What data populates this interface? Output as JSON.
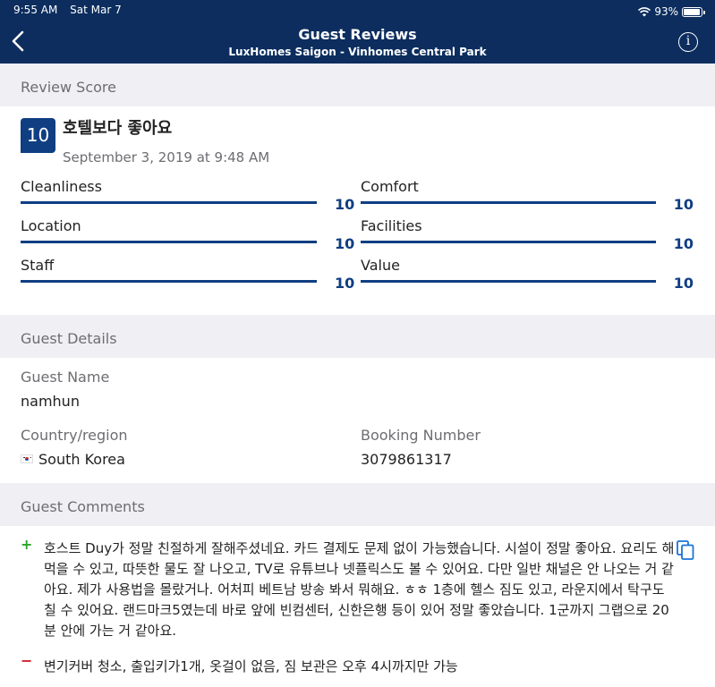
{
  "status": {
    "time": "9:55 AM",
    "date": "Sat Mar 7",
    "battery": "93%",
    "battery_level": 0.93
  },
  "nav": {
    "title": "Guest Reviews",
    "subtitle": "LuxHomes Saigon - Vinhomes Central Park",
    "back_icon": "chevron-left-icon",
    "info_icon": "info-icon",
    "info_glyph": "i"
  },
  "sections": {
    "review_score": "Review Score",
    "guest_details": "Guest Details",
    "guest_comments": "Guest Comments"
  },
  "review": {
    "score": "10",
    "title": "호텔보다 좋아요",
    "date": "September 3, 2019 at 9:48 AM",
    "ratings": [
      {
        "label": "Cleanliness",
        "value": "10",
        "fraction": 1.0
      },
      {
        "label": "Comfort",
        "value": "10",
        "fraction": 1.0
      },
      {
        "label": "Location",
        "value": "10",
        "fraction": 1.0
      },
      {
        "label": "Facilities",
        "value": "10",
        "fraction": 1.0
      },
      {
        "label": "Staff",
        "value": "10",
        "fraction": 1.0
      },
      {
        "label": "Value",
        "value": "10",
        "fraction": 1.0
      }
    ]
  },
  "guest": {
    "name_label": "Guest Name",
    "name": "namhun",
    "country_label": "Country/region",
    "country": "South Korea",
    "booking_label": "Booking Number",
    "booking_number": "3079861317"
  },
  "comments": {
    "positive_mark": "+",
    "negative_mark": "−",
    "positive": "호스트 Duy가 정말 친절하게 잘해주셨네요. 카드 결제도 문제 없이 가능했습니다. 시설이 정말 좋아요. 요리도 해먹을 수 있고, 따뜻한 물도 잘 나오고, TV로 유튜브나 넷플릭스도 볼 수 있어요. 다만 일반 채널은 안 나오는 거 같아요. 제가 사용법을 몰랐거나. 어처피 베트남 방송 봐서 뭐해요. ㅎㅎ 1층에 헬스 짐도 있고, 라운지에서 탁구도 칠 수 있어요. 랜드마크5였는데 바로 앞에 빈컴센터, 신한은행 등이 있어 정말 좋았습니다. 1군까지 그랩으로 20분 안에 가는 거 같아요.",
    "negative": "변기커버 청소, 출입키가1개, 옷걸이 없음, 짐 보관은 오후 4시까지만 가능",
    "copy_icon": "copy-icon"
  },
  "colors": {
    "navy": "#0c2d5e",
    "accent": "#0f3e82",
    "positive": "#2aa52a",
    "negative": "#d0202a",
    "copy": "#1a73d9"
  }
}
